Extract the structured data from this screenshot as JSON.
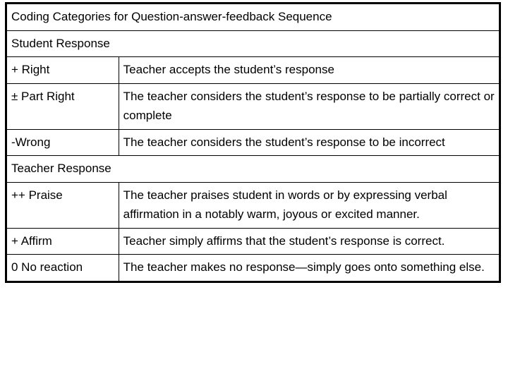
{
  "table": {
    "title": "Coding Categories for Question-answer-feedback Sequence",
    "sections": [
      {
        "heading": "Student Response",
        "rows": [
          {
            "code": "+ Right",
            "description": "Teacher accepts the student’s response"
          },
          {
            "code": "± Part Right",
            "description": "The teacher considers the student’s response to be partially correct or complete"
          },
          {
            "code": "-Wrong",
            "description": "The teacher considers the student’s response to be incorrect"
          }
        ]
      },
      {
        "heading": "Teacher Response",
        "rows": [
          {
            "code": "++ Praise",
            "description": "The teacher praises student in words or by expressing verbal affirmation in a notably warm, joyous or excited manner."
          },
          {
            "code": "+ Affirm",
            "description": "Teacher simply affirms that the student’s response is correct."
          },
          {
            "code": "0 No reaction",
            "description": "The teacher makes no response—simply goes onto something else."
          }
        ]
      }
    ]
  }
}
